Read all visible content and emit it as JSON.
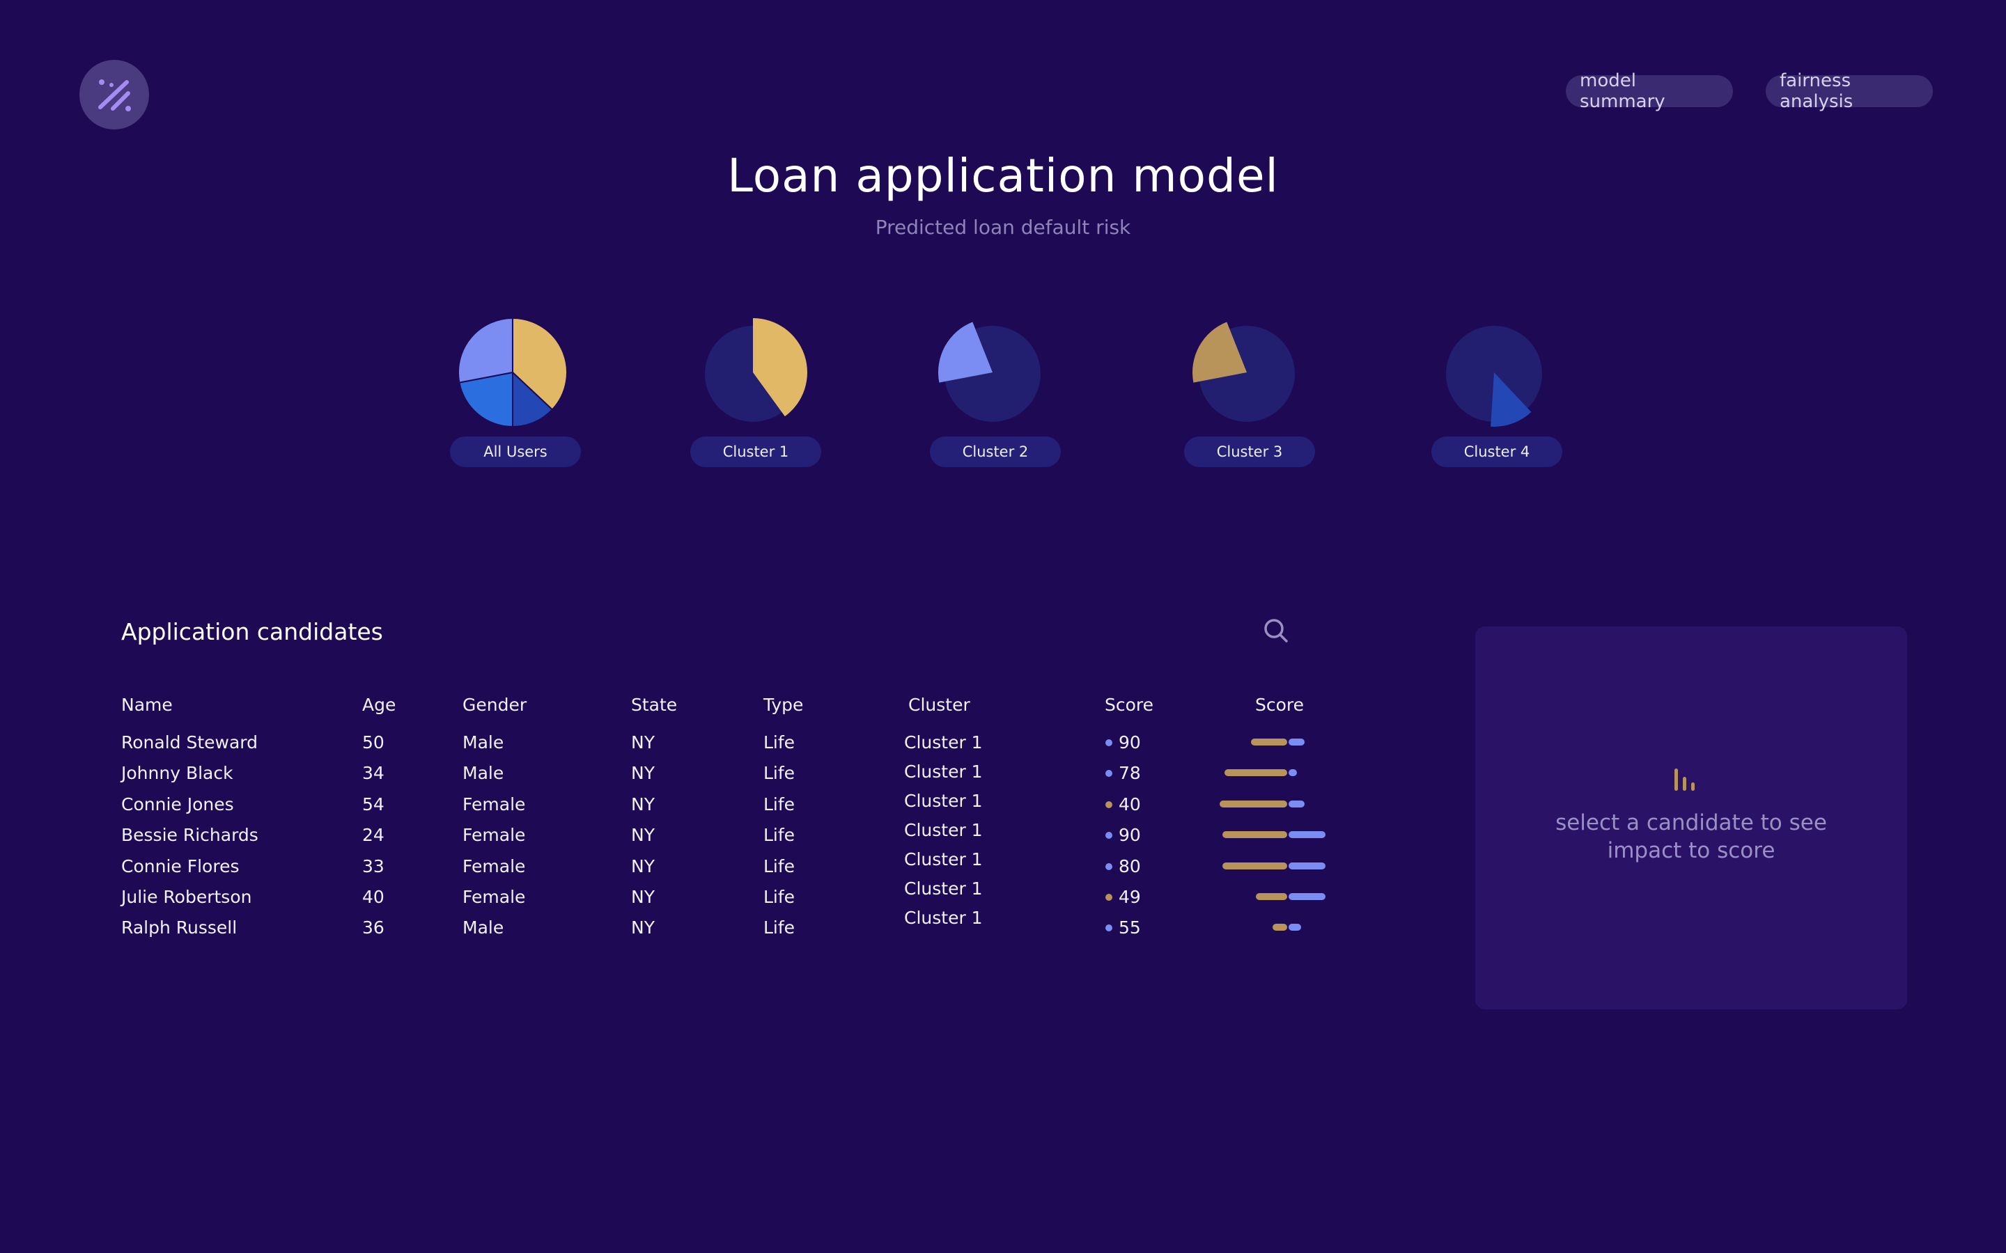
{
  "header": {
    "logo_icon": "percent-icon",
    "nav": [
      {
        "label": "model summary"
      },
      {
        "label": "fairness analysis"
      }
    ],
    "title": "Loan application model",
    "subtitle": "Predicted loan default risk"
  },
  "colors": {
    "background": "#1e0954",
    "gold": "#e0b866",
    "gold_dark": "#b8935a",
    "lavender": "#7b8df2",
    "blue": "#2a6ee0",
    "blue_dark": "#2347b5",
    "pie_bg": "#221f70"
  },
  "clusters": [
    {
      "label": "All Users"
    },
    {
      "label": "Cluster 1"
    },
    {
      "label": "Cluster 2"
    },
    {
      "label": "Cluster 3"
    },
    {
      "label": "Cluster 4"
    }
  ],
  "chart_data": [
    {
      "type": "pie",
      "title": "All Users",
      "slices": [
        {
          "color": "#e0b866",
          "value": 37
        },
        {
          "color": "#2347b5",
          "value": 13
        },
        {
          "color": "#2a6ee0",
          "value": 22
        },
        {
          "color": "#7b8df2",
          "value": 28
        }
      ]
    },
    {
      "type": "pie",
      "title": "Cluster 1",
      "slices": [
        {
          "color": "#e0b866",
          "value": 40
        }
      ]
    },
    {
      "type": "pie",
      "title": "Cluster 2",
      "slices": [
        {
          "color": "#7b8df2",
          "value": 22
        }
      ]
    },
    {
      "type": "pie",
      "title": "Cluster 3",
      "slices": [
        {
          "color": "#b8935a",
          "value": 22
        }
      ]
    },
    {
      "type": "pie",
      "title": "Cluster 4",
      "slices": [
        {
          "color": "#2347b5",
          "value": 13
        }
      ]
    }
  ],
  "table": {
    "title": "Application candidates",
    "columns": [
      "Name",
      "Age",
      "Gender",
      "State",
      "Type",
      "Cluster",
      "Score",
      "Score"
    ],
    "rows": [
      {
        "name": "Ronald Steward",
        "age": "50",
        "gender": "Male",
        "state": "NY",
        "type": "Life",
        "cluster": "Cluster 1",
        "score": "90",
        "dot": "#7b8df2",
        "neg": 0.35,
        "pos": 0.15
      },
      {
        "name": "Johnny Black",
        "age": "34",
        "gender": "Male",
        "state": "NY",
        "type": "Life",
        "cluster": "Cluster 1",
        "score": "78",
        "dot": "#7b8df2",
        "neg": 0.6,
        "pos": 0.08
      },
      {
        "name": "Connie Jones",
        "age": "54",
        "gender": "Female",
        "state": "NY",
        "type": "Life",
        "cluster": "Cluster 1",
        "score": "40",
        "dot": "#b8935a",
        "neg": 0.65,
        "pos": 0.15
      },
      {
        "name": "Bessie Richards",
        "age": "24",
        "gender": "Female",
        "state": "NY",
        "type": "Life",
        "cluster": "Cluster 1",
        "score": "90",
        "dot": "#7b8df2",
        "neg": 0.62,
        "pos": 0.35
      },
      {
        "name": "Connie Flores",
        "age": "33",
        "gender": "Female",
        "state": "NY",
        "type": "Life",
        "cluster": "Cluster 1",
        "score": "80",
        "dot": "#7b8df2",
        "neg": 0.62,
        "pos": 0.35
      },
      {
        "name": "Julie Robertson",
        "age": "40",
        "gender": "Female",
        "state": "NY",
        "type": "Life",
        "cluster": "Cluster 1",
        "score": "49",
        "dot": "#b8935a",
        "neg": 0.3,
        "pos": 0.35
      },
      {
        "name": "Ralph Russell",
        "age": "36",
        "gender": "Male",
        "state": "NY",
        "type": "Life",
        "cluster": "Cluster 1",
        "score": "55",
        "dot": "#7b8df2",
        "neg": 0.14,
        "pos": 0.12
      }
    ]
  },
  "detail_panel": {
    "message": "select a candidate to see impact to score",
    "icon": "bar-chart-icon"
  }
}
